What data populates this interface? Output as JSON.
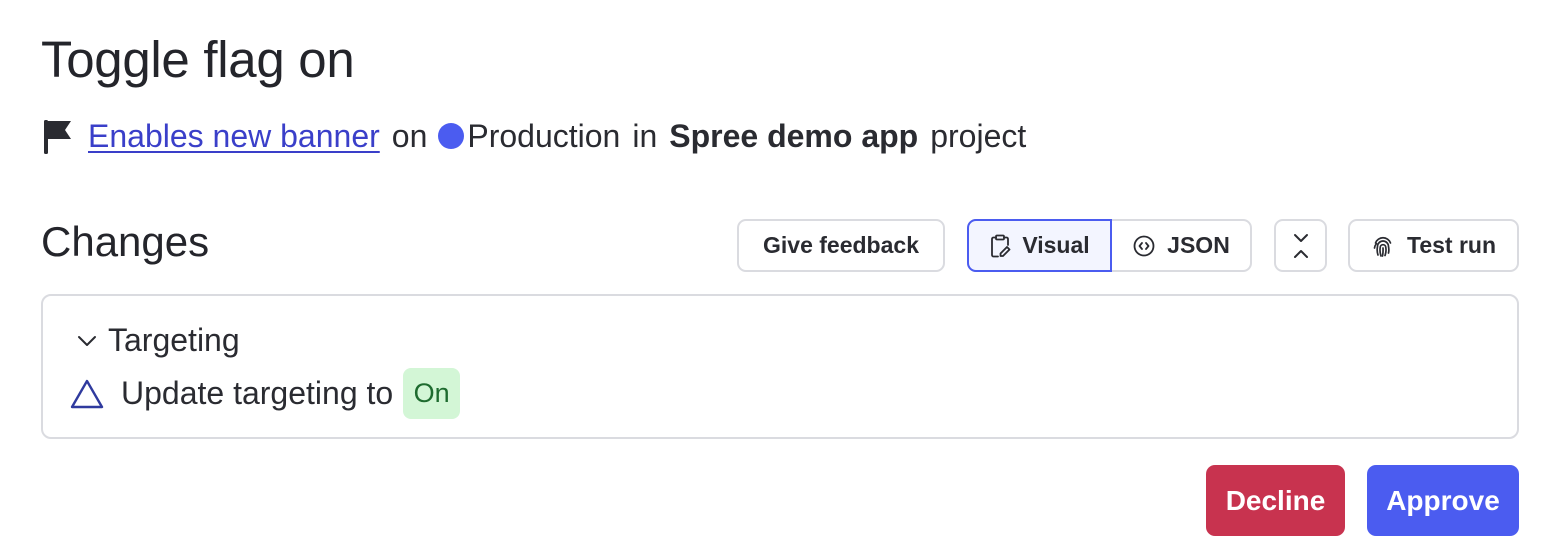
{
  "header": {
    "title": "Toggle flag on",
    "flag_icon": "flag-icon",
    "flag_name": "Enables new banner",
    "on_word": "on",
    "environment": {
      "name": "Production",
      "color": "#4b5cf0"
    },
    "in_word": "in",
    "project_name": "Spree demo app",
    "project_word": "project"
  },
  "changes": {
    "title": "Changes",
    "toolbar": {
      "feedback_label": "Give feedback",
      "view_modes": [
        {
          "label": "Visual",
          "icon": "clipboard-edit-icon",
          "selected": true
        },
        {
          "label": "JSON",
          "icon": "code-circle-icon",
          "selected": false
        }
      ],
      "collapse_icon": "collapse-all-icon",
      "test_run_label": "Test run",
      "test_run_icon": "fingerprint-icon"
    },
    "section": {
      "label": "Targeting",
      "expanded": true,
      "change_text": "Update targeting to",
      "value_badge": "On",
      "badge_color": "#d3f6d6"
    }
  },
  "actions": {
    "decline_label": "Decline",
    "decline_color": "#c8334f",
    "approve_label": "Approve",
    "approve_color": "#4b5cf0"
  }
}
